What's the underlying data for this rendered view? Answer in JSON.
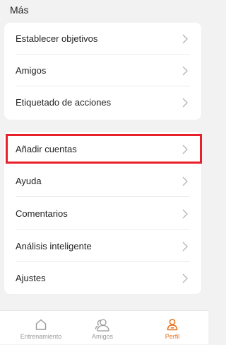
{
  "section": {
    "title": "Más"
  },
  "card1": {
    "items": [
      {
        "label": "Establecer objetivos"
      },
      {
        "label": "Amigos"
      },
      {
        "label": "Etiquetado de acciones"
      }
    ]
  },
  "card2": {
    "items": [
      {
        "label": "Añadir cuentas"
      },
      {
        "label": "Ayuda"
      },
      {
        "label": "Comentarios"
      },
      {
        "label": "Análisis inteligente"
      },
      {
        "label": "Ajustes"
      }
    ]
  },
  "bottom_nav": {
    "items": [
      {
        "label": "Entrenamiento",
        "icon": "home-icon",
        "active": false
      },
      {
        "label": "Amigos",
        "icon": "friends-icon",
        "active": false
      },
      {
        "label": "Perfil",
        "icon": "profile-icon",
        "active": true
      }
    ]
  },
  "colors": {
    "accent": "#e8711c",
    "inactive": "#9a9a9a",
    "highlight_border": "#e8202a",
    "background": "#f2f2f2"
  },
  "icons": {
    "row_chevron": "chevron-right-icon"
  }
}
